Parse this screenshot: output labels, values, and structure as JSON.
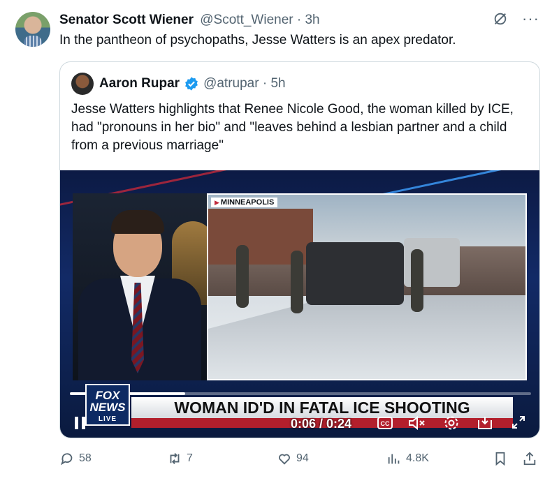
{
  "author": {
    "name": "Senator Scott Wiener",
    "handle_time": "@Scott_Wiener · 3h"
  },
  "tweet_text": "In the pantheon of psychopaths, Jesse Watters is an apex predator.",
  "quoted": {
    "name": "Aaron Rupar",
    "handle_time": "@atrupar · 5h",
    "text": "Jesse Watters highlights that Renee Nicole Good, the woman killed by ICE, had \"pronouns in her bio\" and \"leaves behind a lesbian partner and a child from a previous marriage\"",
    "video": {
      "location_tag": "MINNEAPOLIS",
      "logo_text": "FOX NEWS",
      "logo_sub": "LIVE",
      "chyron": "WOMAN ID'D IN FATAL ICE SHOOTING",
      "time": "0:06 / 0:24",
      "progress": 0.25
    }
  },
  "actions": {
    "replies": "58",
    "reposts": "7",
    "likes": "94",
    "views": "4.8K"
  },
  "colors": {
    "verified": "#1d9bf0",
    "muted_text": "#536471",
    "fox_red": "#b21f2c"
  },
  "icons": [
    "grok-icon",
    "more-icon",
    "verified-icon",
    "play-icon",
    "cc-icon",
    "mute-icon",
    "gear-icon",
    "pip-icon",
    "fullscreen-icon",
    "reply-icon",
    "repost-icon",
    "like-icon",
    "views-icon",
    "bookmark-icon",
    "share-icon"
  ]
}
